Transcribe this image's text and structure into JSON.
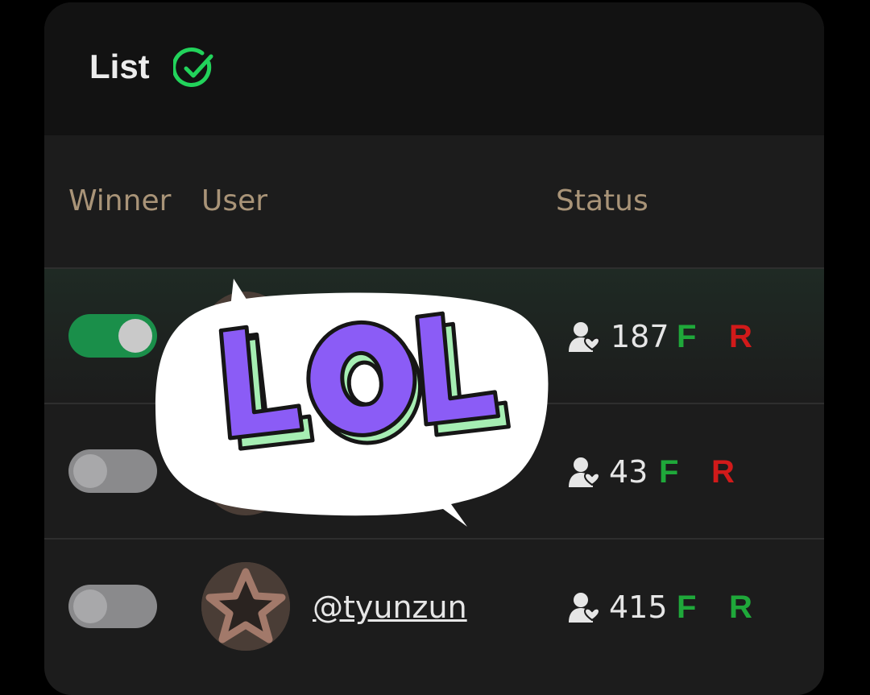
{
  "header": {
    "title": "List"
  },
  "columns": {
    "winner": "Winner",
    "user": "User",
    "status": "Status"
  },
  "rows": [
    {
      "winner": true,
      "handle": "",
      "count": "187",
      "f_label": "F",
      "r_label": "R",
      "f_color": "#1fa83a",
      "r_color": "#d11a1a"
    },
    {
      "winner": false,
      "handle": "",
      "count": "43",
      "f_label": "F",
      "r_label": "R",
      "f_color": "#1fa83a",
      "r_color": "#d11a1a"
    },
    {
      "winner": false,
      "handle": "@tyunzun",
      "count": "415",
      "f_label": "F",
      "r_label": "R",
      "f_color": "#1fa83a",
      "r_color": "#1fa83a"
    }
  ],
  "sticker": {
    "text": "LOL"
  },
  "colors": {
    "accent_green": "#22d35b",
    "header_text": "#a99478"
  }
}
